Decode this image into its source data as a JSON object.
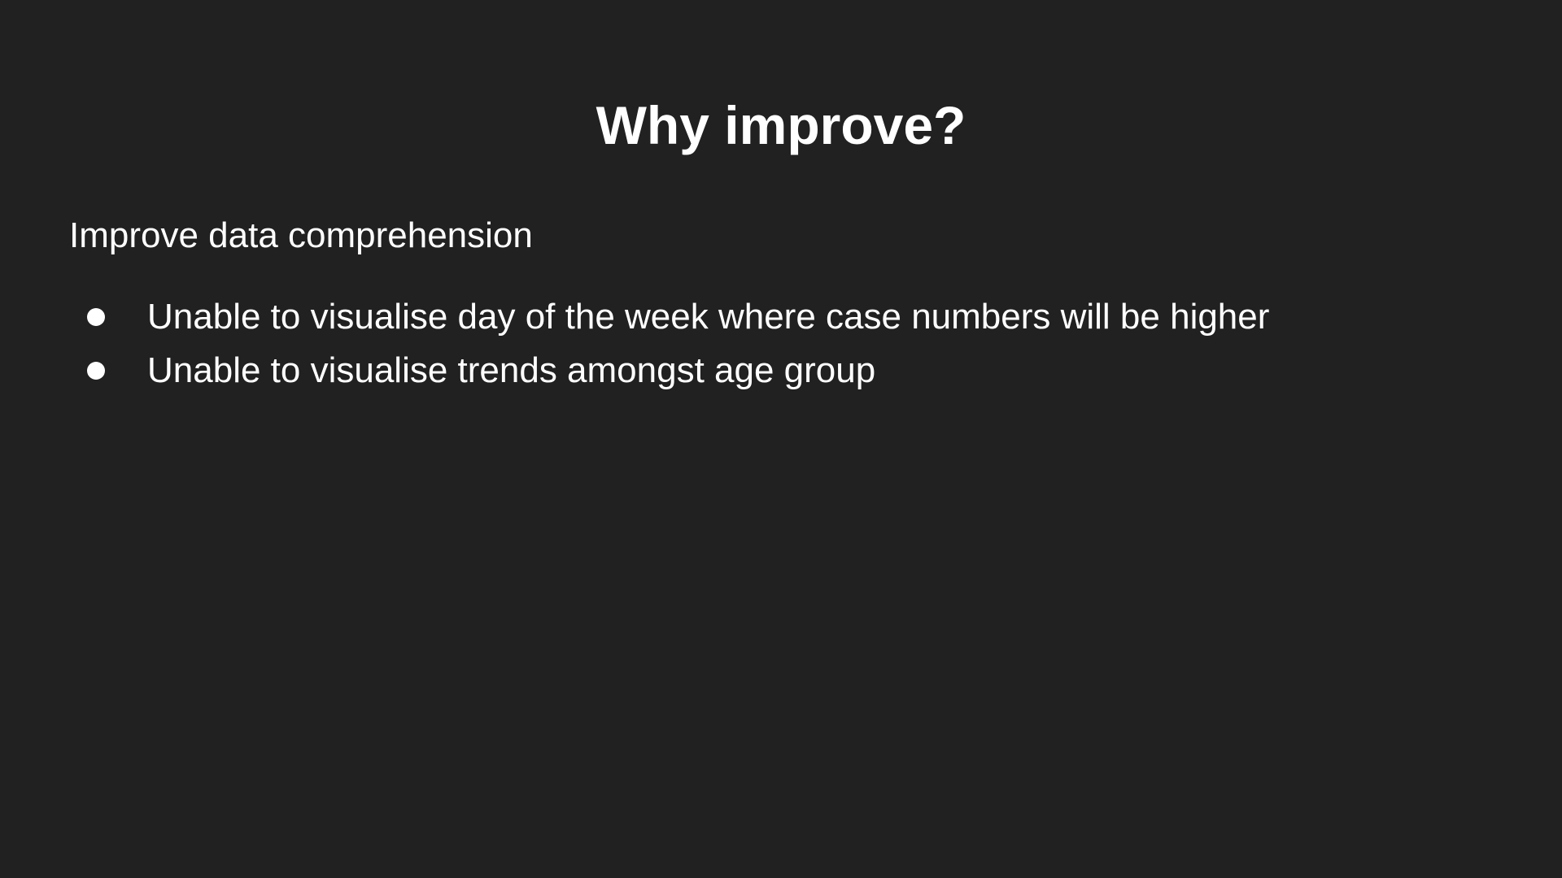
{
  "slide": {
    "background": "#212121",
    "text_color": "#ffffff",
    "title": "Why improve?",
    "heading": "Improve data comprehension",
    "bullets": [
      {
        "text": "Unable to visualise day of the week where case numbers will be higher"
      },
      {
        "text": "Unable to visualise trends amongst age group"
      }
    ]
  }
}
